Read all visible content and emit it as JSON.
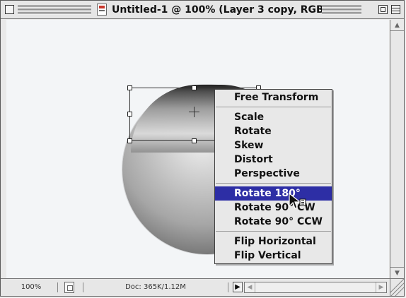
{
  "window": {
    "title": "Untitled-1 @ 100% (Layer 3 copy, RGB)",
    "colors": {
      "chrome": "#e6e6e6",
      "border": "#5a5a5a",
      "menu_highlight": "#2d2ea5",
      "canvas": "#f3f5f7"
    }
  },
  "canvas": {
    "object": "layer-3-copy-sphere",
    "selection": "free-transform-bounding-box"
  },
  "context_menu": {
    "items": [
      {
        "label": "Free Transform",
        "highlighted": false
      },
      {
        "label": "Scale",
        "highlighted": false
      },
      {
        "label": "Rotate",
        "highlighted": false
      },
      {
        "label": "Skew",
        "highlighted": false
      },
      {
        "label": "Distort",
        "highlighted": false
      },
      {
        "label": "Perspective",
        "highlighted": false
      },
      {
        "label": "Rotate 180°",
        "highlighted": true
      },
      {
        "label": "Rotate 90° CW",
        "highlighted": false
      },
      {
        "label": "Rotate 90° CCW",
        "highlighted": false
      },
      {
        "label": "Flip Horizontal",
        "highlighted": false
      },
      {
        "label": "Flip Vertical",
        "highlighted": false
      }
    ]
  },
  "status_bar": {
    "zoom": "100%",
    "doc_info": "Doc: 365K/1.12M",
    "arrow": "▶"
  },
  "icons": {
    "close": "close-box-icon",
    "zoom": "zoom-box-icon",
    "collapse": "collapse-box-icon",
    "document": "document-icon",
    "cursor": "context-menu-cursor-icon"
  }
}
